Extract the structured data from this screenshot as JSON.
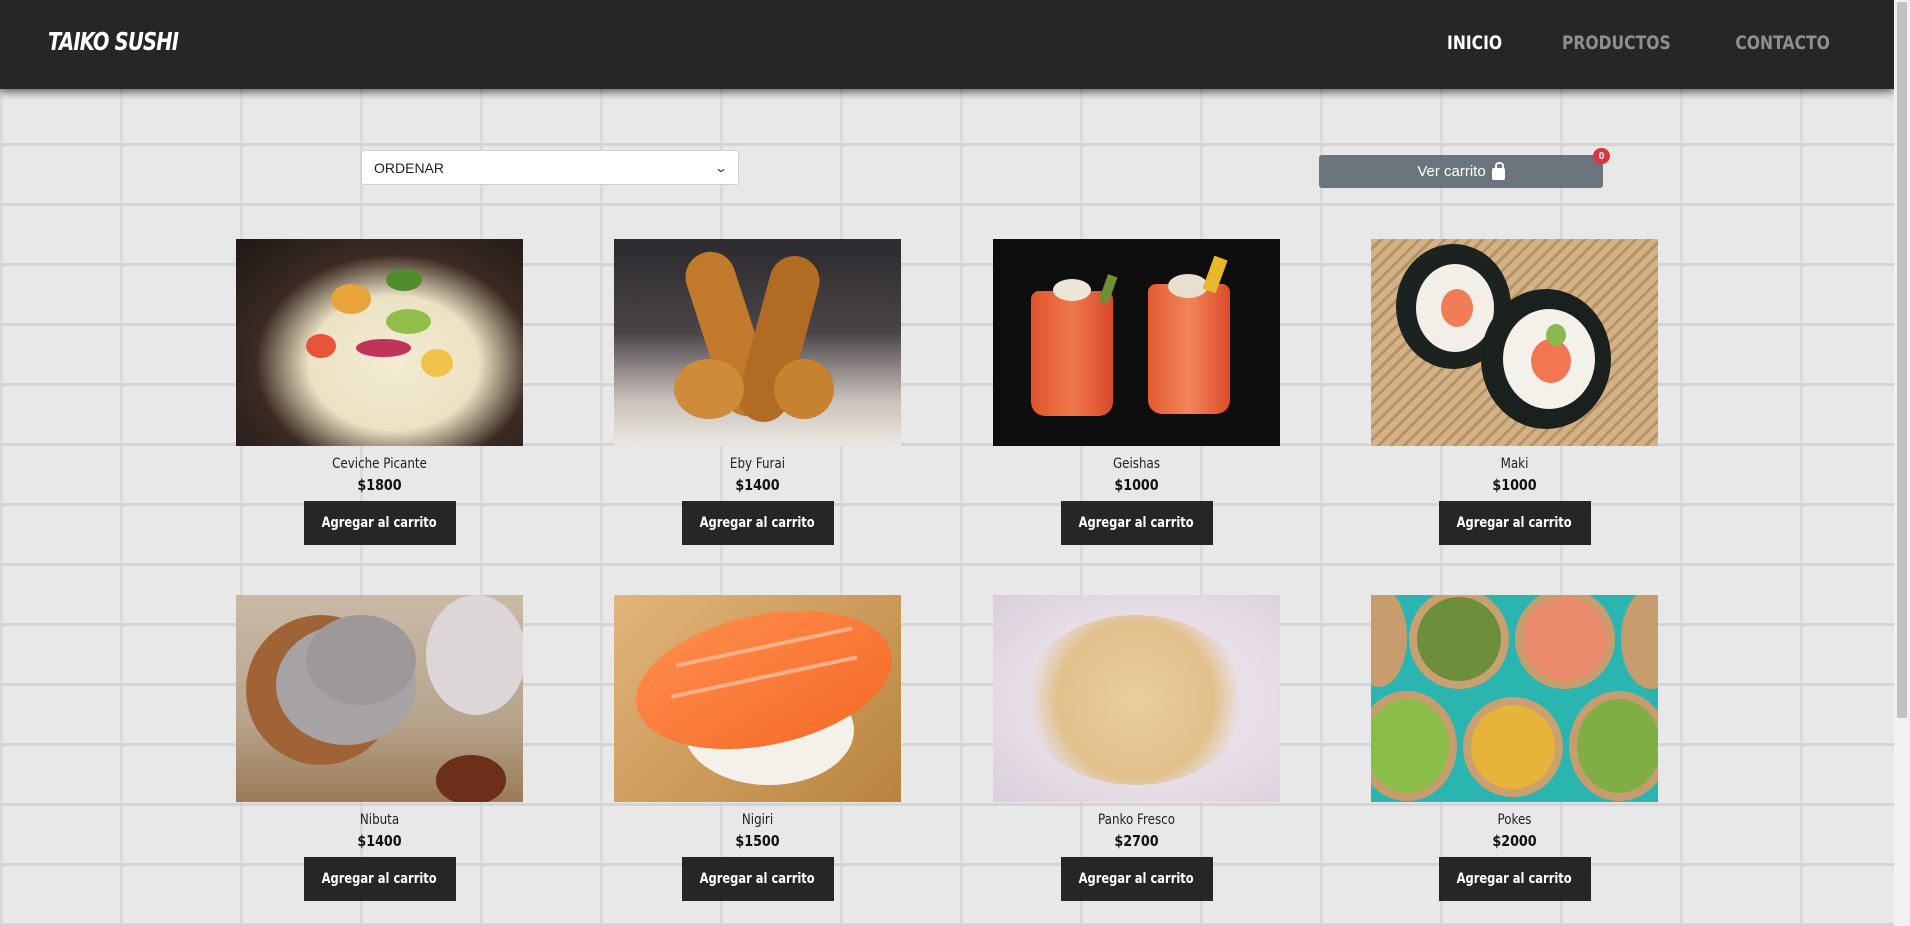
{
  "brand": "TAIKO SUSHI",
  "nav": [
    {
      "label": "INICIO",
      "active": true
    },
    {
      "label": "PRODUCTOS",
      "active": false
    },
    {
      "label": "CONTACTO",
      "active": false
    }
  ],
  "sort": {
    "selected": "ORDENAR"
  },
  "cart": {
    "label": "Ver carrito",
    "count": "0"
  },
  "add_label": "Agregar al carrito",
  "products": [
    {
      "name": "Ceviche Picante",
      "price": "$1800"
    },
    {
      "name": "Eby Furai",
      "price": "$1400"
    },
    {
      "name": "Geishas",
      "price": "$1000"
    },
    {
      "name": "Maki",
      "price": "$1000"
    },
    {
      "name": "Nibuta",
      "price": "$1400"
    },
    {
      "name": "Nigiri",
      "price": "$1500"
    },
    {
      "name": "Panko Fresco",
      "price": "$2700"
    },
    {
      "name": "Pokes",
      "price": "$2000"
    }
  ],
  "colors": {
    "navbar": "#262626",
    "cart_button": "#6c757d",
    "badge": "#dc3545"
  }
}
